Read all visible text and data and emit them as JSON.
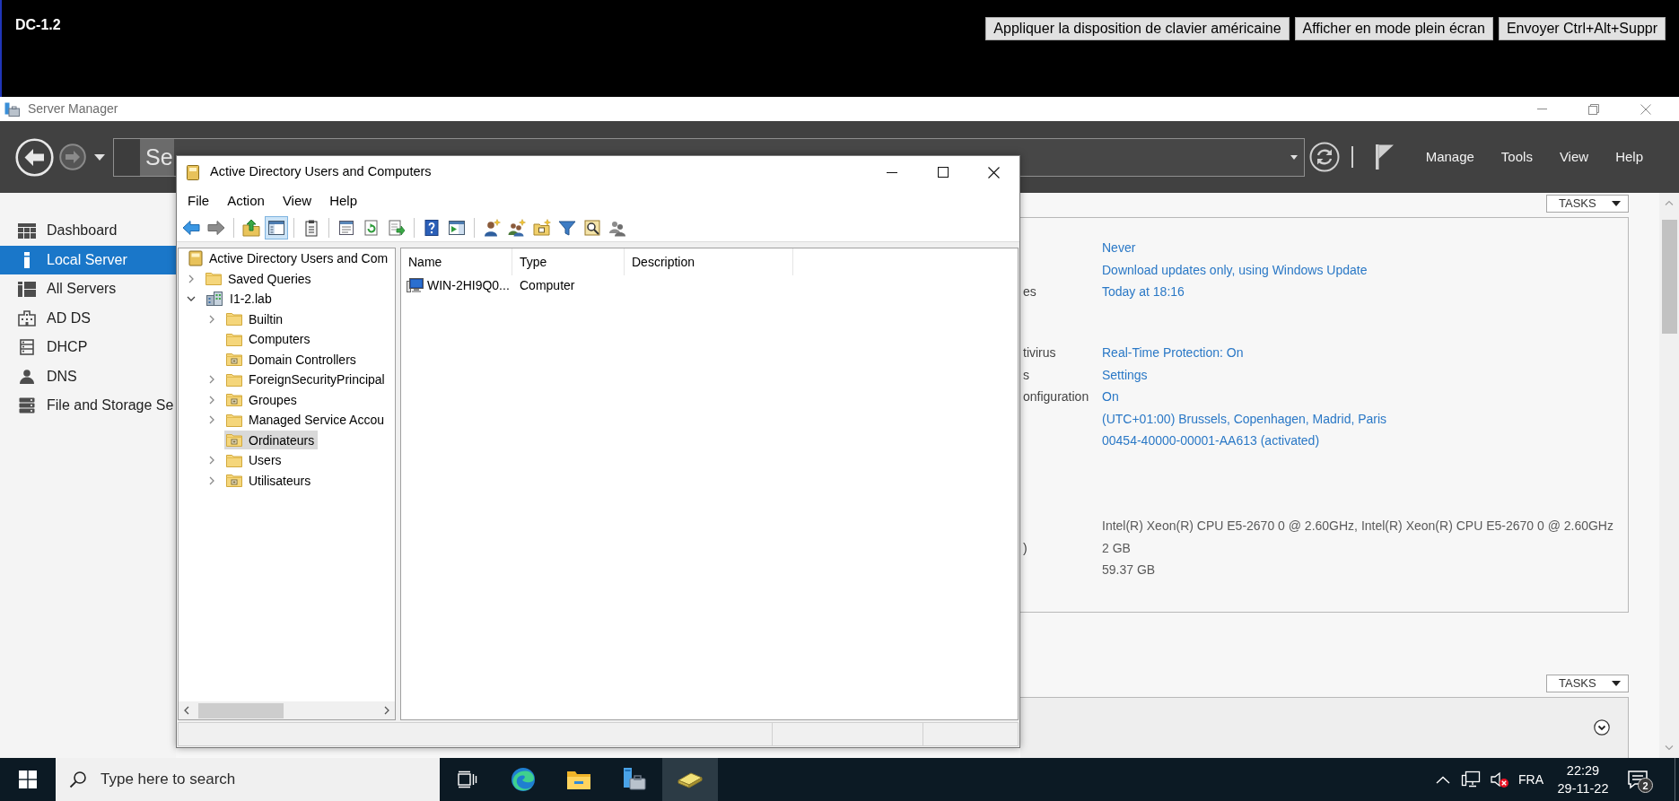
{
  "remote_bar": {
    "title": "DC-1.2",
    "buttons": [
      "Appliquer la disposition de clavier américaine",
      "Afficher en mode plein écran",
      "Envoyer Ctrl+Alt+Suppr"
    ]
  },
  "server_manager": {
    "title": "Server Manager",
    "breadcrumb": "Se",
    "menu": [
      "Manage",
      "Tools",
      "View",
      "Help"
    ],
    "sidebar": [
      {
        "label": "Dashboard",
        "kind": "dashboard",
        "selected": false
      },
      {
        "label": "Local Server",
        "kind": "server",
        "selected": true
      },
      {
        "label": "All Servers",
        "kind": "servers",
        "selected": false
      },
      {
        "label": "AD DS",
        "kind": "adds",
        "selected": false
      },
      {
        "label": "DHCP",
        "kind": "dhcp",
        "selected": false
      },
      {
        "label": "DNS",
        "kind": "dns",
        "selected": false
      },
      {
        "label": "File and Storage Se",
        "kind": "storage",
        "selected": false
      }
    ],
    "properties": {
      "tasks": "TASKS",
      "groups": [
        [
          {
            "value": "Never",
            "kind": "link"
          },
          {
            "value": "Download updates only, using Windows Update",
            "kind": "link"
          },
          {
            "label": "es",
            "value": "Today at 18:16",
            "kind": "link"
          }
        ],
        [
          {
            "label": "tivirus",
            "value": "Real-Time Protection: On",
            "kind": "link"
          },
          {
            "label": "s",
            "value": "Settings",
            "kind": "link"
          },
          {
            "label": "onfiguration",
            "value": "On",
            "kind": "link"
          },
          {
            "value": "(UTC+01:00) Brussels, Copenhagen, Madrid, Paris",
            "kind": "link"
          },
          {
            "value": "00454-40000-00001-AA613 (activated)",
            "kind": "link"
          }
        ],
        [
          {
            "value": "Intel(R) Xeon(R) CPU E5-2670 0 @ 2.60GHz, Intel(R) Xeon(R) CPU E5-2670 0 @ 2.60GHz",
            "kind": "text"
          },
          {
            "label": ")",
            "value": "2 GB",
            "kind": "text"
          },
          {
            "value": "59.37 GB",
            "kind": "text"
          }
        ]
      ]
    },
    "events": {
      "tasks": "TASKS"
    }
  },
  "aduc": {
    "title": "Active Directory Users and Computers",
    "menu": [
      "File",
      "Action",
      "View",
      "Help"
    ],
    "toolbar": [
      [
        {
          "kind": "back",
          "pressed": false
        },
        {
          "kind": "forward",
          "pressed": false
        }
      ],
      [
        {
          "kind": "up",
          "pressed": false
        },
        {
          "kind": "tree",
          "pressed": true
        }
      ],
      [
        {
          "kind": "clipboard",
          "pressed": false
        }
      ],
      [
        {
          "kind": "properties",
          "pressed": false
        },
        {
          "kind": "refresh",
          "pressed": false
        },
        {
          "kind": "export",
          "pressed": false
        }
      ],
      [
        {
          "kind": "help",
          "pressed": false
        },
        {
          "kind": "actionpane",
          "pressed": false
        }
      ],
      [
        {
          "kind": "user",
          "pressed": false
        },
        {
          "kind": "group",
          "pressed": false
        },
        {
          "kind": "ou",
          "pressed": false
        },
        {
          "kind": "filter",
          "pressed": false
        },
        {
          "kind": "find",
          "pressed": false
        },
        {
          "kind": "addgroup",
          "pressed": false
        }
      ]
    ],
    "tree": [
      {
        "label": "Active Directory Users and Com",
        "kind": "root",
        "selected": false,
        "children": [
          {
            "label": "Saved Queries",
            "kind": "folder",
            "expanded": false,
            "selected": false
          },
          {
            "label": "I1-2.lab",
            "kind": "domain",
            "expanded": true,
            "selected": false,
            "children": [
              {
                "label": "Builtin",
                "kind": "folder",
                "expanded": false,
                "selected": false
              },
              {
                "label": "Computers",
                "kind": "folder",
                "selected": false
              },
              {
                "label": "Domain Controllers",
                "kind": "ou",
                "selected": false
              },
              {
                "label": "ForeignSecurityPrincipal",
                "kind": "folder",
                "expanded": false,
                "selected": false
              },
              {
                "label": "Groupes",
                "kind": "ou",
                "expanded": false,
                "selected": false
              },
              {
                "label": "Managed Service Accou",
                "kind": "folder",
                "expanded": false,
                "selected": false
              },
              {
                "label": "Ordinateurs",
                "kind": "ou",
                "selected": true
              },
              {
                "label": "Users",
                "kind": "folder",
                "expanded": false,
                "selected": false
              },
              {
                "label": "Utilisateurs",
                "kind": "ou",
                "expanded": false,
                "selected": false
              }
            ]
          }
        ]
      }
    ],
    "list": {
      "columns": [
        "Name",
        "Type",
        "Description"
      ],
      "rows": [
        {
          "kind": "computer",
          "cells": [
            "WIN-2HI9Q0...",
            "Computer"
          ],
          "selected": false
        }
      ]
    }
  },
  "taskbar": {
    "search": {
      "placeholder": "Type here to search"
    },
    "apps": [
      {
        "kind": "taskview",
        "selected": false
      },
      {
        "kind": "edge",
        "selected": false
      },
      {
        "kind": "explorer",
        "selected": false
      },
      {
        "kind": "servermanager",
        "selected": false
      },
      {
        "kind": "aduc",
        "selected": true
      }
    ],
    "language": "FRA",
    "time": "22:29",
    "date": "29-11-22",
    "notifications": "2"
  }
}
